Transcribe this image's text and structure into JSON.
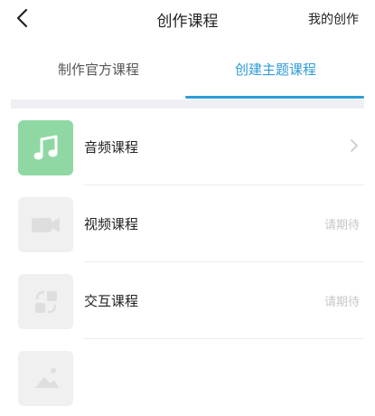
{
  "header": {
    "title": "创作课程",
    "right_action": "我的创作",
    "back_icon": "chevron-left-icon"
  },
  "tabs": [
    {
      "label": "制作官方课程",
      "active": false
    },
    {
      "label": "创建主题课程",
      "active": true
    }
  ],
  "accent_color": "#2e9bd6",
  "courses": [
    {
      "label": "音频课程",
      "icon": "music-note-icon",
      "status": "",
      "trailing": "chevron-right-icon",
      "icon_bg": "#8fd8a4"
    },
    {
      "label": "视频课程",
      "icon": "video-camera-icon",
      "status": "请期待",
      "trailing": "",
      "icon_bg": "#f0f0f0"
    },
    {
      "label": "交互课程",
      "icon": "interactive-icon",
      "status": "请期待",
      "trailing": "",
      "icon_bg": "#f0f0f0"
    },
    {
      "label": "",
      "icon": "image-icon",
      "status": "",
      "trailing": "",
      "icon_bg": "#f0f0f0"
    }
  ]
}
